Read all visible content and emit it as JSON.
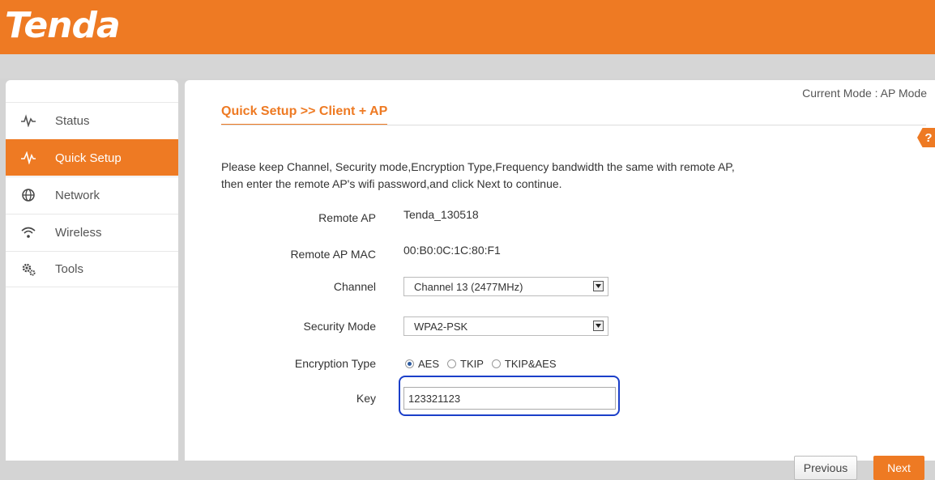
{
  "brand": {
    "logo_text": "Tenda",
    "accent": "#ee7a23"
  },
  "sidebar": {
    "items": [
      {
        "label": "Status",
        "icon": "pulse-icon",
        "active": false
      },
      {
        "label": "Quick Setup",
        "icon": "quick-setup-icon",
        "active": true
      },
      {
        "label": "Network",
        "icon": "globe-icon",
        "active": false
      },
      {
        "label": "Wireless",
        "icon": "wifi-icon",
        "active": false
      },
      {
        "label": "Tools",
        "icon": "gears-icon",
        "active": false
      }
    ]
  },
  "main": {
    "current_mode": "Current Mode : AP Mode",
    "title": "Quick Setup >>  Client + AP",
    "help_label": "?",
    "description_line1": "Please keep Channel, Security mode,Encryption Type,Frequency bandwidth the same with remote AP,",
    "description_line2": "then enter the remote AP's wifi password,and click Next to continue.",
    "form": {
      "remote_ap_label": "Remote AP",
      "remote_ap_value": "Tenda_130518",
      "remote_ap_mac_label": "Remote AP MAC",
      "remote_ap_mac_value": "00:B0:0C:1C:80:F1",
      "channel_label": "Channel",
      "channel_value": "Channel 13 (2477MHz)",
      "security_label": "Security Mode",
      "security_value": "WPA2-PSK",
      "encryption_label": "Encryption Type",
      "encryption_options": [
        "AES",
        "TKIP",
        "TKIP&AES"
      ],
      "encryption_selected": "AES",
      "key_label": "Key",
      "key_value": "123321123"
    },
    "buttons": {
      "previous": "Previous",
      "next": "Next"
    }
  }
}
